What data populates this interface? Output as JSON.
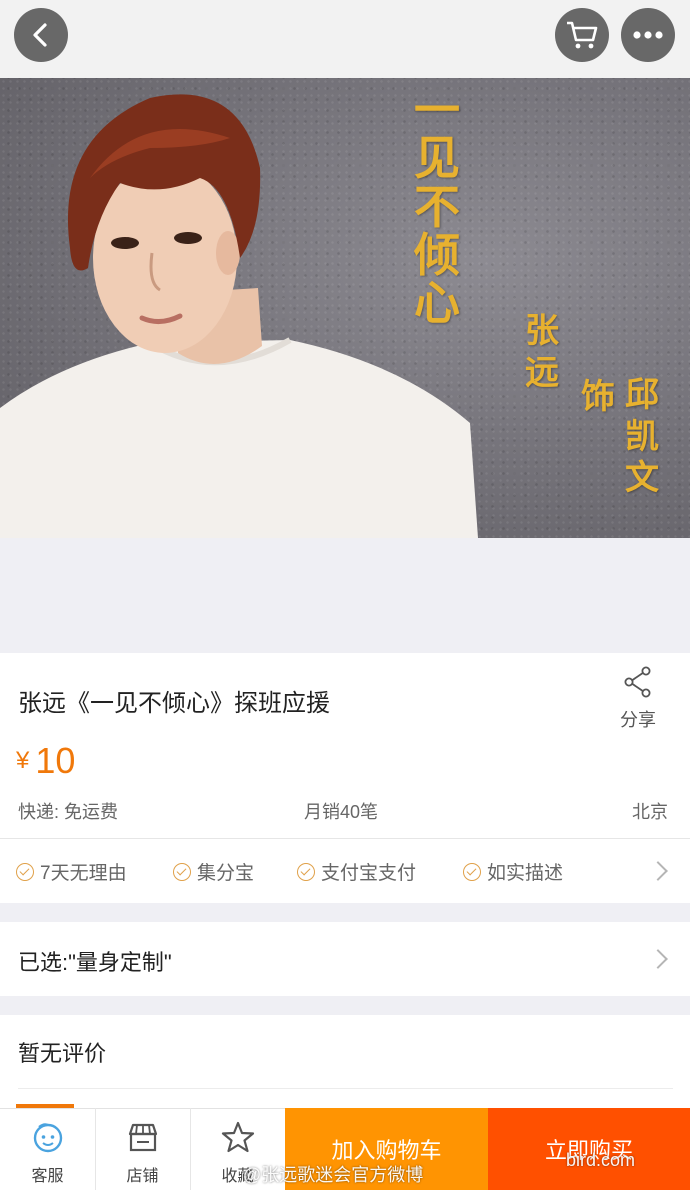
{
  "header": {
    "back_icon": "chevron-left-icon",
    "cart_icon": "shopping-cart-icon",
    "more_icon": "more-dots-icon"
  },
  "hero": {
    "poster_title_chars": [
      "一",
      "见",
      "不",
      "倾",
      "心"
    ],
    "poster_credit_cols": [
      [
        "张",
        "远"
      ],
      [
        "饰"
      ],
      [
        "邱",
        "凯",
        "文"
      ]
    ]
  },
  "product": {
    "title": "张远《一见不倾心》探班应援",
    "share_label": "分享",
    "currency": "¥",
    "price": "10",
    "price_color": "#f0780a",
    "shipping": "快递: 免运费",
    "monthly_sales": "月销40笔",
    "location": "北京",
    "guarantees": [
      "7天无理由",
      "集分宝",
      "支付宝支付",
      "如实描述"
    ]
  },
  "selected": {
    "text": "已选:\"量身定制\""
  },
  "reviews": {
    "title": "暂无评价"
  },
  "bottom_bar": {
    "service_label": "客服",
    "store_label": "店铺",
    "favorite_label": "收藏",
    "add_to_cart_label": "加入购物车",
    "buy_now_label": "立即购买",
    "add_to_cart_color": "#ff9402",
    "buy_now_color": "#ff5000"
  },
  "watermark": {
    "text": "@张远歌迷会官方微博",
    "site": "bird.com"
  }
}
